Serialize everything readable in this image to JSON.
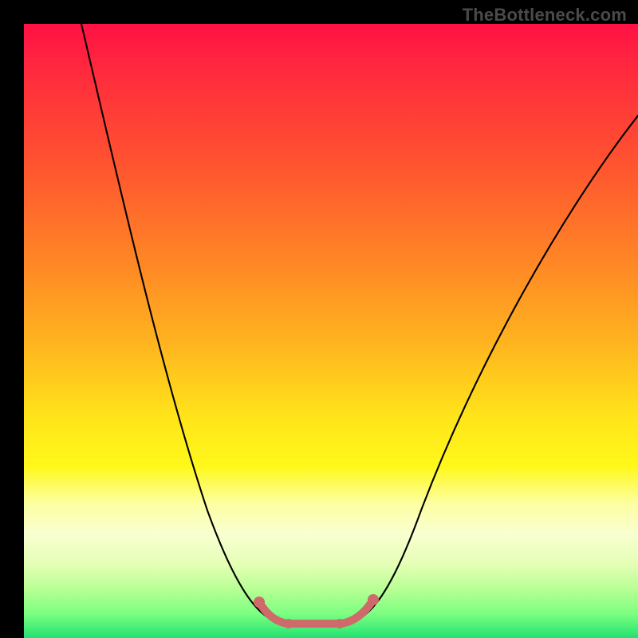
{
  "watermark": "TheBottleneck.com",
  "chart_data": {
    "type": "line",
    "title": "",
    "xlabel": "",
    "ylabel": "",
    "x": [
      0.0,
      0.05,
      0.1,
      0.15,
      0.2,
      0.25,
      0.3,
      0.35,
      0.4,
      0.45,
      0.475,
      0.5,
      0.55,
      0.6,
      0.65,
      0.7,
      0.75,
      0.8,
      0.85,
      0.9,
      0.95,
      1.0
    ],
    "series": [
      {
        "name": "bottleneck-curve",
        "values": [
          1.3,
          1.12,
          1.0,
          0.86,
          0.7,
          0.52,
          0.34,
          0.18,
          0.06,
          0.02,
          0.0,
          0.02,
          0.1,
          0.22,
          0.36,
          0.5,
          0.62,
          0.72,
          0.78,
          0.82,
          0.84,
          0.85
        ]
      }
    ],
    "highlight_range_x": [
      0.38,
      0.57
    ],
    "ylim": [
      0,
      1
    ],
    "xlim": [
      0,
      1
    ],
    "background_gradient": {
      "top": "#ff1144",
      "mid": "#ffe41a",
      "bottom": "#22e270"
    },
    "notes": "Axes are unlabeled in the source image; x and y are normalized 0–1. Values estimated from gridless rendering."
  },
  "colors": {
    "frame_background": "#000000",
    "curve": "#000000",
    "highlight": "#cf6a6a",
    "watermark": "#4a4a4a"
  }
}
